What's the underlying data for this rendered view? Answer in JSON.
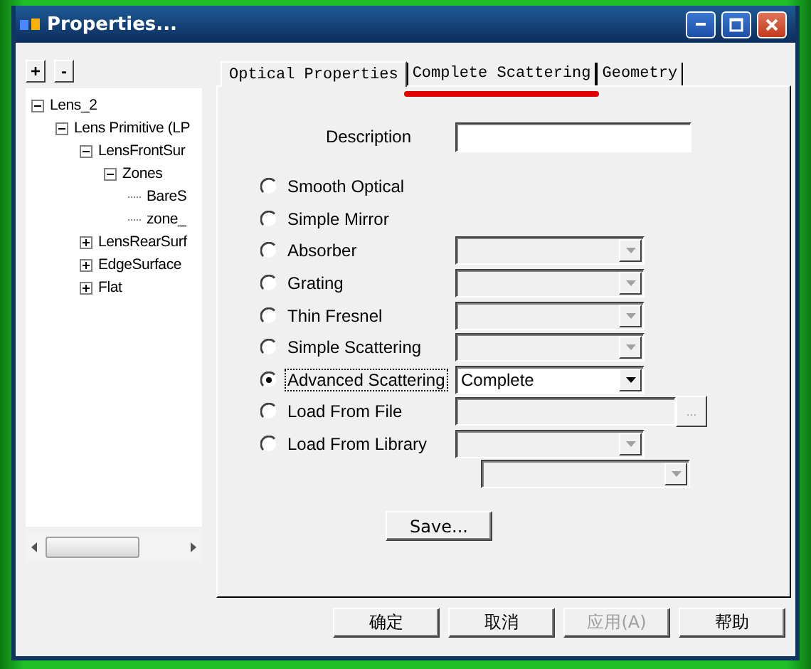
{
  "window": {
    "title": "Properties..."
  },
  "tree_buttons": [
    "+",
    "-"
  ],
  "tree": [
    {
      "label": "Lens_2",
      "expanded": true,
      "children": [
        {
          "label": "Lens Primitive (LP",
          "expanded": true,
          "children": [
            {
              "label": "LensFrontSur",
              "expanded": true,
              "children": [
                {
                  "label": "Zones",
                  "expanded": true,
                  "children": [
                    {
                      "label": "BareS"
                    },
                    {
                      "label": "zone_"
                    }
                  ]
                }
              ]
            },
            {
              "label": "LensRearSurf",
              "expanded": false
            },
            {
              "label": "EdgeSurface",
              "expanded": false
            },
            {
              "label": "Flat",
              "expanded": false
            }
          ]
        }
      ]
    }
  ],
  "tabs": [
    {
      "label": "Optical Properties",
      "selected": true,
      "annotated": false
    },
    {
      "label": "Complete Scattering",
      "selected": false,
      "annotated": true
    },
    {
      "label": "Geometry",
      "selected": false,
      "annotated": false
    }
  ],
  "description": {
    "label": "Description"
  },
  "options": [
    {
      "label": "Smooth Optical",
      "selected": false,
      "kind": "none"
    },
    {
      "label": "Simple Mirror",
      "selected": false,
      "kind": "none"
    },
    {
      "label": "Absorber",
      "selected": false,
      "kind": "dropdown",
      "disabled": true
    },
    {
      "label": "Grating",
      "selected": false,
      "kind": "dropdown",
      "disabled": true
    },
    {
      "label": "Thin Fresnel",
      "selected": false,
      "kind": "dropdown",
      "disabled": true
    },
    {
      "label": "Simple Scattering",
      "selected": false,
      "kind": "dropdown",
      "disabled": true
    },
    {
      "label": "Advanced Scattering",
      "selected": true,
      "kind": "dropdown",
      "disabled": false,
      "value": "Complete"
    },
    {
      "label": "Load From File",
      "selected": false,
      "kind": "file",
      "disabled": true,
      "browse_label": "..."
    },
    {
      "label": "Load From Library",
      "selected": false,
      "kind": "library",
      "disabled": true
    }
  ],
  "save_button": {
    "label": "Save..."
  },
  "buttons": [
    {
      "label": "确定",
      "disabled": false
    },
    {
      "label": "取消",
      "disabled": false
    },
    {
      "label": "应用(A)",
      "disabled": true
    },
    {
      "label": "帮助",
      "disabled": false
    }
  ]
}
